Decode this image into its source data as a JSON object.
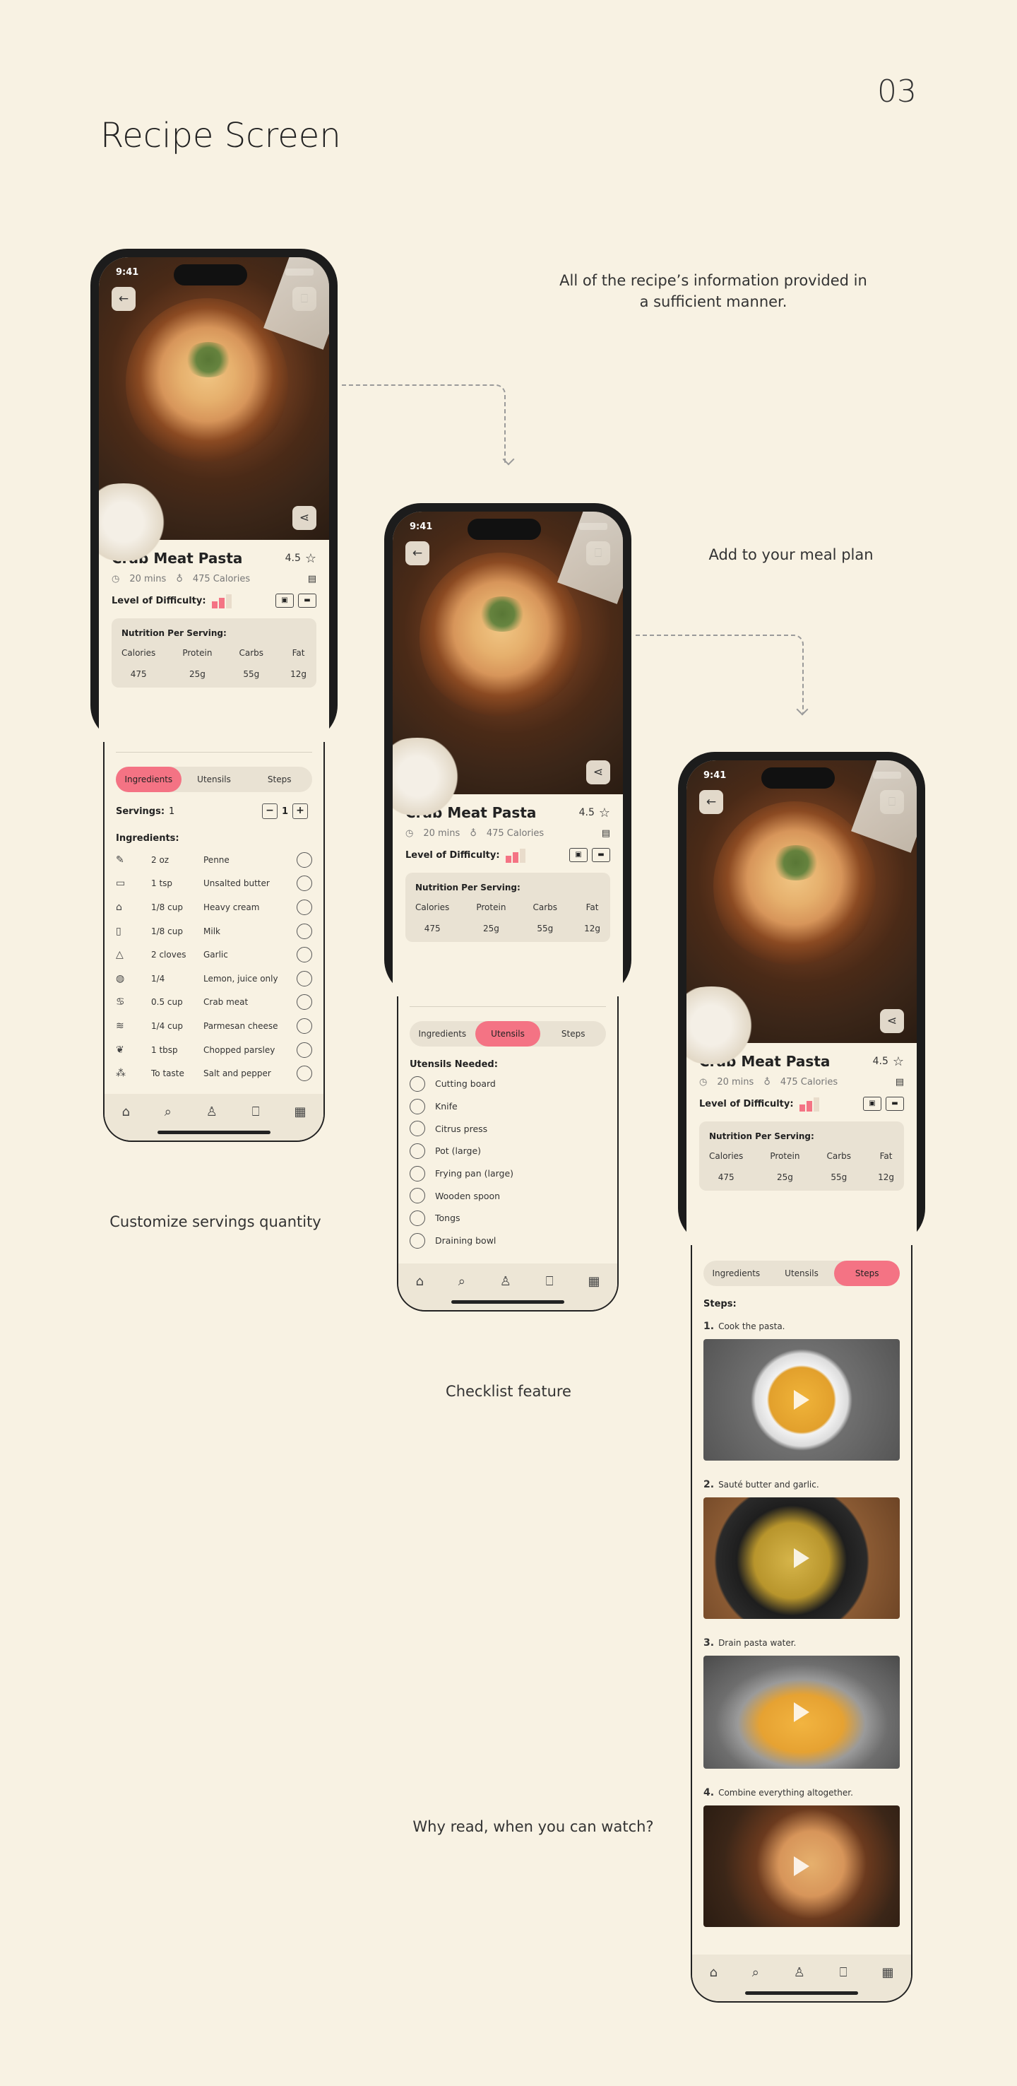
{
  "page": {
    "number": "03",
    "title": "Recipe Screen"
  },
  "captions": {
    "info": "All of the recipe’s information provided in a sufficient manner.",
    "meal_plan": "Add to your meal plan",
    "servings": "Customize servings quantity",
    "checklist": "Checklist feature",
    "watch": "Why read, when you can watch?"
  },
  "recipe": {
    "status_time": "9:41",
    "title": "Crab Meat Pasta",
    "rating": "4.5",
    "time": "20 mins",
    "calories": "475 Calories",
    "difficulty_label": "Level of Difficulty:",
    "difficulty_level": 2,
    "difficulty_max": 3,
    "nutrition_title": "Nutrition Per Serving:",
    "nutrition": [
      {
        "label": "Calories",
        "value": "475"
      },
      {
        "label": "Protein",
        "value": "25g"
      },
      {
        "label": "Carbs",
        "value": "55g"
      },
      {
        "label": "Fat",
        "value": "12g"
      }
    ],
    "tabs": [
      "Ingredients",
      "Utensils",
      "Steps"
    ]
  },
  "ingredients_screen": {
    "servings_label": "Servings:",
    "servings_value": "1",
    "stepper_value": "1",
    "list_label": "Ingredients:",
    "items": [
      {
        "icon": "penne-icon",
        "glyph": "✎",
        "qty": "2 oz",
        "name": "Penne"
      },
      {
        "icon": "butter-icon",
        "glyph": "▭",
        "qty": "1 tsp",
        "name": "Unsalted butter"
      },
      {
        "icon": "bottle-icon",
        "glyph": "⌂",
        "qty": "1/8 cup",
        "name": "Heavy cream"
      },
      {
        "icon": "milk-icon",
        "glyph": "▯",
        "qty": "1/8 cup",
        "name": "Milk"
      },
      {
        "icon": "garlic-icon",
        "glyph": "△",
        "qty": "2 cloves",
        "name": "Garlic"
      },
      {
        "icon": "lemon-icon",
        "glyph": "◍",
        "qty": "1/4",
        "name": "Lemon, juice only"
      },
      {
        "icon": "crab-icon",
        "glyph": "♋",
        "qty": "0.5 cup",
        "name": "Crab meat"
      },
      {
        "icon": "cheese-icon",
        "glyph": "≋",
        "qty": "1/4 cup",
        "name": "Parmesan cheese"
      },
      {
        "icon": "parsley-icon",
        "glyph": "❦",
        "qty": "1 tbsp",
        "name": "Chopped parsley"
      },
      {
        "icon": "salt-pepper-icon",
        "glyph": "⁂",
        "qty": "To taste",
        "name": "Salt and pepper"
      }
    ]
  },
  "utensils_screen": {
    "label": "Utensils Needed:",
    "items": [
      "Cutting board",
      "Knife",
      "Citrus press",
      "Pot (large)",
      "Frying pan (large)",
      "Wooden spoon",
      "Tongs",
      "Draining bowl"
    ]
  },
  "steps_screen": {
    "label": "Steps:",
    "steps": [
      {
        "num": "1.",
        "text": "Cook the pasta."
      },
      {
        "num": "2.",
        "text": "Sauté butter and garlic."
      },
      {
        "num": "3.",
        "text": "Drain pasta water."
      },
      {
        "num": "4.",
        "text": "Combine everything altogether."
      }
    ]
  },
  "tabbar": [
    {
      "icon": "home-icon",
      "glyph": "⌂"
    },
    {
      "icon": "search-icon",
      "glyph": "⌕"
    },
    {
      "icon": "profile-icon",
      "glyph": "♙"
    },
    {
      "icon": "bookmark-icon",
      "glyph": "⎕"
    },
    {
      "icon": "calendar-icon",
      "glyph": "▦"
    }
  ],
  "colors": {
    "accent": "#f47384",
    "background": "#f8f2e3",
    "card": "#e9e2d3"
  }
}
